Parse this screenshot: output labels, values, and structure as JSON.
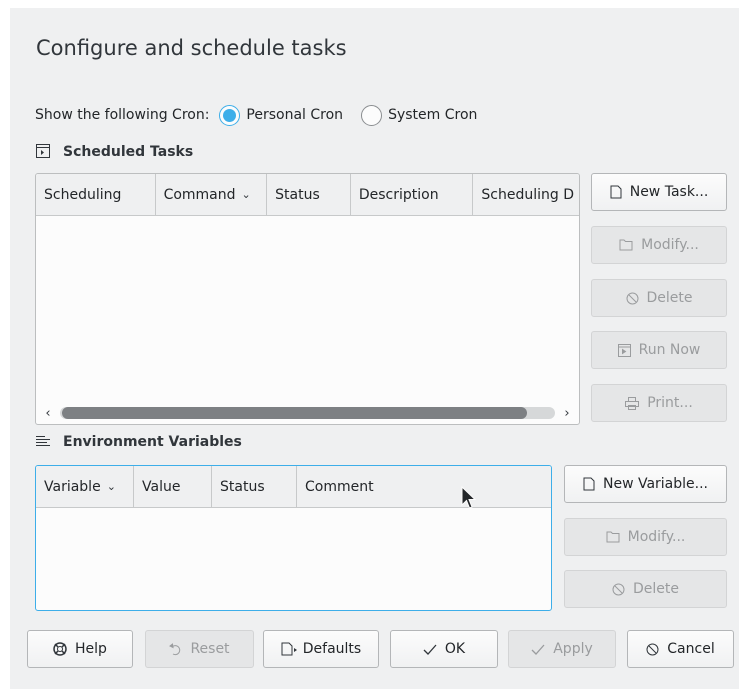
{
  "title": "Configure and schedule tasks",
  "cron": {
    "label": "Show the following Cron:",
    "personal_label": "Personal Cron",
    "system_label": "System Cron",
    "selected": "Personal Cron"
  },
  "tasks": {
    "header": "Scheduled Tasks",
    "columns": [
      "Scheduling",
      "Command",
      "Status",
      "Description",
      "Scheduling D"
    ],
    "sorted_column": "Command",
    "rows": [],
    "buttons": {
      "new": "New Task...",
      "modify": "Modify...",
      "delete": "Delete",
      "run": "Run Now",
      "print": "Print..."
    }
  },
  "variables": {
    "header": "Environment Variables",
    "columns": [
      "Variable",
      "Value",
      "Status",
      "Comment"
    ],
    "sorted_column": "Variable",
    "rows": [],
    "buttons": {
      "new": "New Variable...",
      "modify": "Modify...",
      "delete": "Delete"
    }
  },
  "footer": {
    "help": "Help",
    "reset": "Reset",
    "defaults": "Defaults",
    "ok": "OK",
    "apply": "Apply",
    "cancel": "Cancel"
  },
  "colors": {
    "accent": "#3daee9",
    "window_bg": "#eff0f1",
    "view_bg": "#fcfcfc",
    "text": "#232629",
    "disabled_text": "#9a9c9e"
  },
  "icons": {
    "scheduled_tasks": "terminal-icon",
    "environment_variables": "list-icon",
    "new": "document-new-icon",
    "modify": "folder-icon",
    "delete": "cancel-circle-icon",
    "run": "terminal-icon",
    "print": "printer-icon",
    "help": "help-lifebuoy-icon",
    "reset": "undo-icon",
    "defaults": "document-defaults-icon",
    "ok": "checkmark-icon",
    "apply": "checkmark-icon",
    "cancel": "cancel-circle-icon"
  }
}
